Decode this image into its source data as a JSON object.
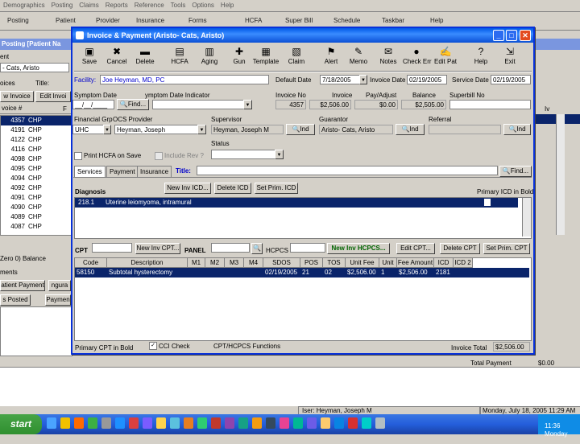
{
  "app": {
    "menu": [
      "Demographics",
      "Posting",
      "Claims",
      "Reports",
      "Reference",
      "Tools",
      "Options",
      "Help"
    ],
    "toolbar": [
      "Posting",
      "Patient",
      "Provider",
      "Insurance",
      "Forms",
      "HCFA",
      "Super Bill",
      "Schedule",
      "Taskbar",
      "Help"
    ]
  },
  "background": {
    "panel_title": "Posting [Patient Na",
    "patient_label": "ent",
    "patient_value": "- Cats, Aristo",
    "invoices_label": "oices",
    "title_label": "Title:",
    "view_invoice_btn": "w Invoice",
    "edit_invoice_btn": "Edit Invoi",
    "col_invoice": "voice #",
    "col_f": "F",
    "col_iv": "Iv",
    "invoices": [
      {
        "num": "4357",
        "type": "CHP"
      },
      {
        "num": "4191",
        "type": "CHP"
      },
      {
        "num": "4122",
        "type": "CHP"
      },
      {
        "num": "4116",
        "type": "CHP"
      },
      {
        "num": "4098",
        "type": "CHP"
      },
      {
        "num": "4095",
        "type": "CHP"
      },
      {
        "num": "4094",
        "type": "CHP"
      },
      {
        "num": "4092",
        "type": "CHP"
      },
      {
        "num": "4091",
        "type": "CHP"
      },
      {
        "num": "4090",
        "type": "CHP"
      },
      {
        "num": "4089",
        "type": "CHP"
      },
      {
        "num": "4087",
        "type": "CHP"
      }
    ],
    "balance_label": "Zero 0) Balance",
    "payments_label": "ments",
    "patient_payment_btn": "atient Payment",
    "ngura_btn": "ngura",
    "posted_tab": "s Posted",
    "payment_tab": "Paymen",
    "total_payment_label": "Total Payment",
    "total_payment_value": "$0.00",
    "status_user": "Joseph M"
  },
  "dialog": {
    "title": "Invoice & Payment (Aristo- Cats, Aristo)",
    "tools": [
      {
        "label": "Save",
        "icon": "floppy-icon",
        "glyph": "▣"
      },
      {
        "label": "Cancel",
        "icon": "cancel-icon",
        "glyph": "✖"
      },
      {
        "label": "Delete",
        "icon": "delete-icon",
        "glyph": "▬"
      },
      {
        "label": "HCFA",
        "icon": "hcfa-icon",
        "glyph": "▤"
      },
      {
        "label": "Aging",
        "icon": "aging-icon",
        "glyph": "▥"
      },
      {
        "label": "Gun",
        "icon": "gun-icon",
        "glyph": "✚"
      },
      {
        "label": "Template",
        "icon": "template-icon",
        "glyph": "▦"
      },
      {
        "label": "Claim",
        "icon": "claim-icon",
        "glyph": "▧"
      },
      {
        "label": "Alert",
        "icon": "alert-icon",
        "glyph": "⚑"
      },
      {
        "label": "Memo",
        "icon": "memo-icon",
        "glyph": "✎"
      },
      {
        "label": "Notes",
        "icon": "notes-icon",
        "glyph": "✉"
      },
      {
        "label": "Check Err",
        "icon": "check-error-icon",
        "glyph": "●"
      },
      {
        "label": "Edit Pat",
        "icon": "edit-patient-icon",
        "glyph": "✍"
      },
      {
        "label": "Help",
        "icon": "help-icon",
        "glyph": "?"
      },
      {
        "label": "Exit",
        "icon": "exit-icon",
        "glyph": "⇲"
      }
    ],
    "facility_label": "Facility:",
    "facility_value": "Joe Heyman, MD, PC",
    "default_date_label": "Default Date",
    "default_date_value": "7/18/2005",
    "invoice_date_label": "Invoice Date",
    "invoice_date_value": "02/19/2005",
    "service_date_label": "Service Date",
    "service_date_value": "02/19/2005",
    "symptom_date_label": "Symptom Date",
    "symptom_date_value": "__/__/____",
    "find_btn": "Find...",
    "symptom_indicator_label": "ymptom Date Indicator",
    "invoice_no_label": "Invoice No",
    "invoice_no_value": "4357",
    "invoice_label": "Invoice",
    "invoice_value": "$2,506.00",
    "pay_adjust_label": "Pay/Adjust",
    "pay_adjust_value": "$0.00",
    "balance_label": "Balance",
    "balance_value": "$2,505.00",
    "superbill_label": "Superbill No",
    "financial_grp_label": "Financial Grp",
    "financial_grp_value": "UHC",
    "ocs_provider_label": "OCS Provider",
    "ocs_provider_value": "Heyman, Joseph",
    "supervisor_label": "Supervisor",
    "supervisor_value": "Heyman, Joseph M",
    "guarantor_label": "Guarantor",
    "guarantor_value": "Aristo- Cats, Aristo",
    "referral_label": "Referral",
    "ind_btn": "Ind",
    "status_label": "Status",
    "print_hcfa_label": "Print HCFA on Save",
    "include_rev_label": "Include Rev ?",
    "tabs": [
      "Services",
      "Payment",
      "Insurance"
    ],
    "title_label": "Title:",
    "diagnosis_label": "Diagnosis",
    "new_inv_icd_btn": "New Inv ICD...",
    "delete_icd_btn": "Delete ICD",
    "set_prim_icd_btn": "Set Prim. ICD",
    "primary_icd_note": "Primary ICD in Bold",
    "diagnosis_items": [
      {
        "code": "218.1",
        "desc": "Uterine leiomyoma, intramural"
      }
    ],
    "cpt_label": "CPT",
    "new_inv_cpt_btn": "New Inv CPT...",
    "panel_label": "PANEL",
    "hcpcs_label": "HCPCS",
    "new_inv_hcpcs_btn": "New Inv HCPCS...",
    "edit_cpt_btn": "Edit CPT...",
    "delete_cpt_btn": "Delete CPT",
    "set_prim_cpt_btn": "Set Prim. CPT",
    "columns": [
      "Code",
      "Description",
      "M1",
      "M2",
      "M3",
      "M4",
      "SDOS",
      "POS",
      "TOS",
      "Unit Fee",
      "Unit",
      "Fee Amount",
      "ICD",
      "ICD 2"
    ],
    "rows": [
      [
        "58150",
        "Subtotal hysterectomy",
        "",
        "",
        "",
        "",
        "02/19/2005",
        "21",
        "02",
        "$2,506.00",
        "1",
        "$2,506.00",
        "2181",
        ""
      ]
    ],
    "primary_cpt_note": "Primary CPT in Bold",
    "cci_check_label": "CCI Check",
    "cpt_hcpcs_functions": "CPT/HCPCS Functions",
    "invoice_total_label": "Invoice Total",
    "invoice_total_value": "$2,506.00"
  },
  "status_bar": {
    "user_prefix": "Iser: Heyman, Joseph M",
    "datetime": "Monday, July 18, 2005 11:29 AM"
  },
  "taskbar": {
    "start": "start",
    "clock": "11:36",
    "day": "Monday"
  }
}
